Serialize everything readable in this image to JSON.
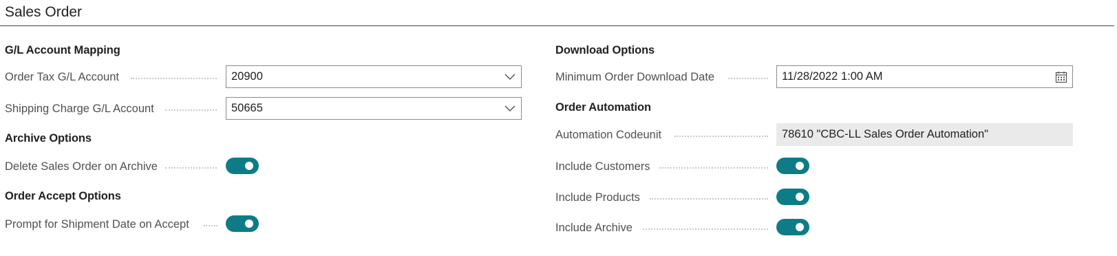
{
  "page": {
    "title": "Sales Order"
  },
  "left": {
    "gl_group": {
      "title": "G/L Account Mapping",
      "fields": [
        {
          "label": "Order Tax G/L Account",
          "value": "20900",
          "icon": "chevron-down-icon"
        },
        {
          "label": "Shipping Charge G/L Account",
          "value": "50665",
          "icon": "chevron-down-icon"
        }
      ]
    },
    "archive_group": {
      "title": "Archive Options",
      "fields": [
        {
          "label": "Delete Sales Order on Archive",
          "value": true
        }
      ]
    },
    "accept_group": {
      "title": "Order Accept Options",
      "fields": [
        {
          "label": "Prompt for Shipment Date on Accept",
          "value": true
        }
      ]
    }
  },
  "right": {
    "download_group": {
      "title": "Download Options",
      "fields": [
        {
          "label": "Minimum Order Download Date",
          "value": "11/28/2022 1:00 AM",
          "icon": "calendar-icon"
        }
      ]
    },
    "automation_group": {
      "title": "Order Automation",
      "fields": [
        {
          "label": "Automation Codeunit",
          "value": "78610 \"CBC-LL Sales Order Automation\""
        },
        {
          "label": "Include Customers",
          "value": true
        },
        {
          "label": "Include Products",
          "value": true
        },
        {
          "label": "Include Archive",
          "value": true
        }
      ]
    }
  },
  "colors": {
    "toggle_on": "#0e7c86",
    "header_rule": "#2b4a5e",
    "label_text": "#505050",
    "readonly_bg": "#eaeaea"
  }
}
